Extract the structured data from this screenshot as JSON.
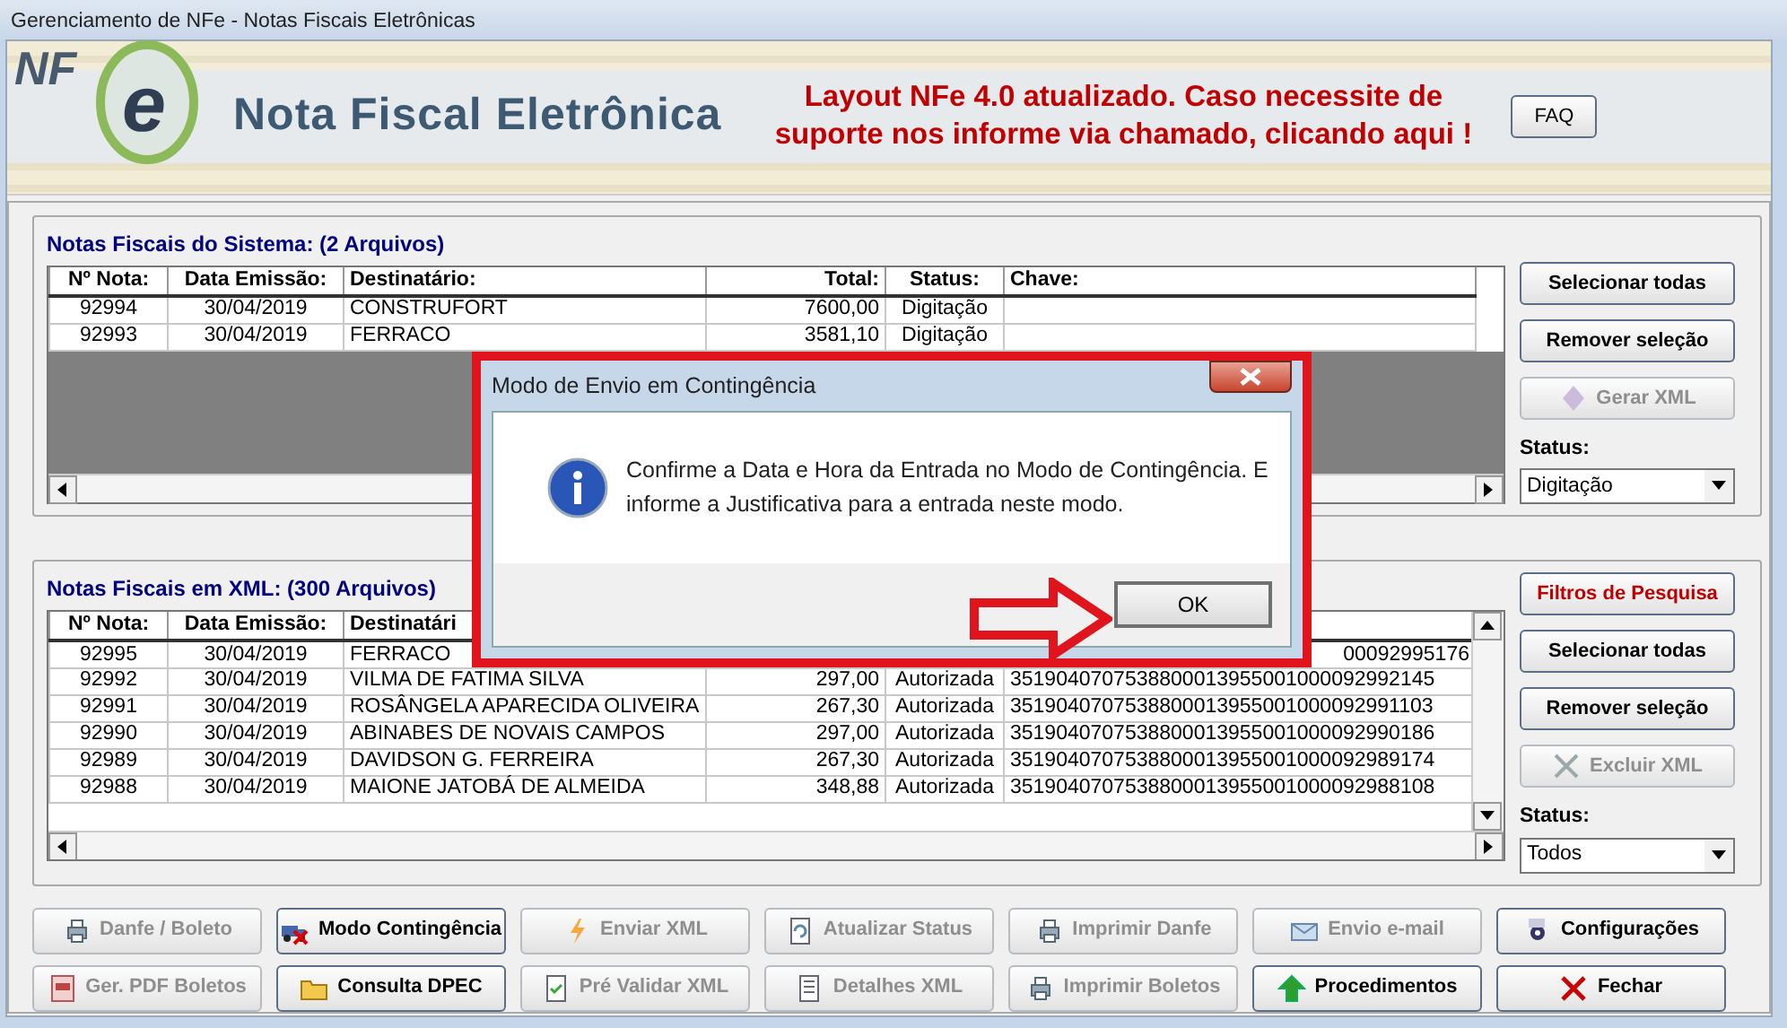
{
  "window": {
    "title": "Gerenciamento de NFe - Notas Fiscais Eletrônicas"
  },
  "banner": {
    "logo_text": [
      "NF",
      "e"
    ],
    "title": "Nota Fiscal Eletrônica",
    "notice": "Layout NFe 4.0 atualizado. Caso necessite de suporte nos informe via chamado, clicando aqui !",
    "faq_button": "FAQ"
  },
  "system_panel": {
    "title": "Notas Fiscais do Sistema: (2 Arquivos)",
    "table": {
      "columns": [
        "Nº Nota:",
        "Data Emissão:",
        "Destinatário:",
        "Total:",
        "Status:",
        "Chave:"
      ],
      "rows": [
        {
          "kind": "full",
          "cells": [
            "92994",
            "30/04/2019",
            "CONSTRUFORT",
            "7600,00",
            "Digitação",
            ""
          ]
        },
        {
          "kind": "full",
          "cells": [
            "92993",
            "30/04/2019",
            "FERRACO",
            "3581,10",
            "Digitação",
            ""
          ]
        }
      ]
    },
    "buttons": [
      {
        "label": "Selecionar todas",
        "disabled": false,
        "highlight": false
      },
      {
        "label": "Remover seleção",
        "disabled": false,
        "highlight": false
      },
      {
        "label": "Gerar XML",
        "disabled": true,
        "highlight": false
      }
    ],
    "status_label": "Status:",
    "status_value": "Digitação"
  },
  "xml_panel": {
    "title": "Notas Fiscais em XML: (300 Arquivos)",
    "table": {
      "columns": [
        "Nº Nota:",
        "Data Emissão:",
        "Destinatári",
        "",
        "",
        ""
      ],
      "rows": [
        {
          "kind": "covered",
          "cells": [
            "92995",
            "30/04/2019",
            "FERRACO",
            "",
            "",
            "00092995176"
          ]
        },
        {
          "kind": "full",
          "cells": [
            "92992",
            "30/04/2019",
            "VILMA DE FATIMA SILVA",
            "297,00",
            "Autorizada",
            "3519040707538800013955001000092992145"
          ]
        },
        {
          "kind": "full",
          "cells": [
            "92991",
            "30/04/2019",
            "ROSÂNGELA  APARECIDA OLIVEIRA",
            "267,30",
            "Autorizada",
            "3519040707538800013955001000092991103"
          ]
        },
        {
          "kind": "full",
          "cells": [
            "92990",
            "30/04/2019",
            "ABINABES DE NOVAIS CAMPOS",
            "297,00",
            "Autorizada",
            "3519040707538800013955001000092990186"
          ]
        },
        {
          "kind": "full",
          "cells": [
            "92989",
            "30/04/2019",
            "DAVIDSON G. FERREIRA",
            "267,30",
            "Autorizada",
            "3519040707538800013955001000092989174"
          ]
        },
        {
          "kind": "full",
          "cells": [
            "92988",
            "30/04/2019",
            "MAIONE JATOBÁ DE ALMEIDA",
            "348,88",
            "Autorizada",
            "3519040707538800013955001000092988108"
          ]
        }
      ]
    },
    "buttons": [
      {
        "label": "Filtros de Pesquisa",
        "disabled": false,
        "highlight": true
      },
      {
        "label": "Selecionar todas",
        "disabled": false,
        "highlight": false
      },
      {
        "label": "Remover seleção",
        "disabled": false,
        "highlight": false
      },
      {
        "label": "Excluir XML",
        "disabled": true,
        "highlight": false
      }
    ],
    "status_label": "Status:",
    "status_value": "Todos"
  },
  "actions": [
    {
      "label": "Danfe / Boleto",
      "disabled": true
    },
    {
      "label": "Modo Contingência",
      "disabled": false
    },
    {
      "label": "Enviar XML",
      "disabled": true
    },
    {
      "label": "Atualizar Status",
      "disabled": true
    },
    {
      "label": "Imprimir Danfe",
      "disabled": true
    },
    {
      "label": "Envio e-mail",
      "disabled": true
    },
    {
      "label": "Configurações",
      "disabled": false
    },
    {
      "label": "Ger. PDF Boletos",
      "disabled": true
    },
    {
      "label": "Consulta DPEC",
      "disabled": false
    },
    {
      "label": "Pré Validar XML",
      "disabled": true
    },
    {
      "label": "Detalhes XML",
      "disabled": true
    },
    {
      "label": "Imprimir Boletos",
      "disabled": true
    },
    {
      "label": "Procedimentos",
      "disabled": false
    },
    {
      "label": "Fechar",
      "disabled": false
    }
  ],
  "dialog": {
    "title": "Modo de Envio em Contingência",
    "message": "Confirme a Data e Hora da Entrada no Modo de Contingência. E informe a Justificativa para a entrada neste modo.",
    "ok_button": "OK"
  }
}
